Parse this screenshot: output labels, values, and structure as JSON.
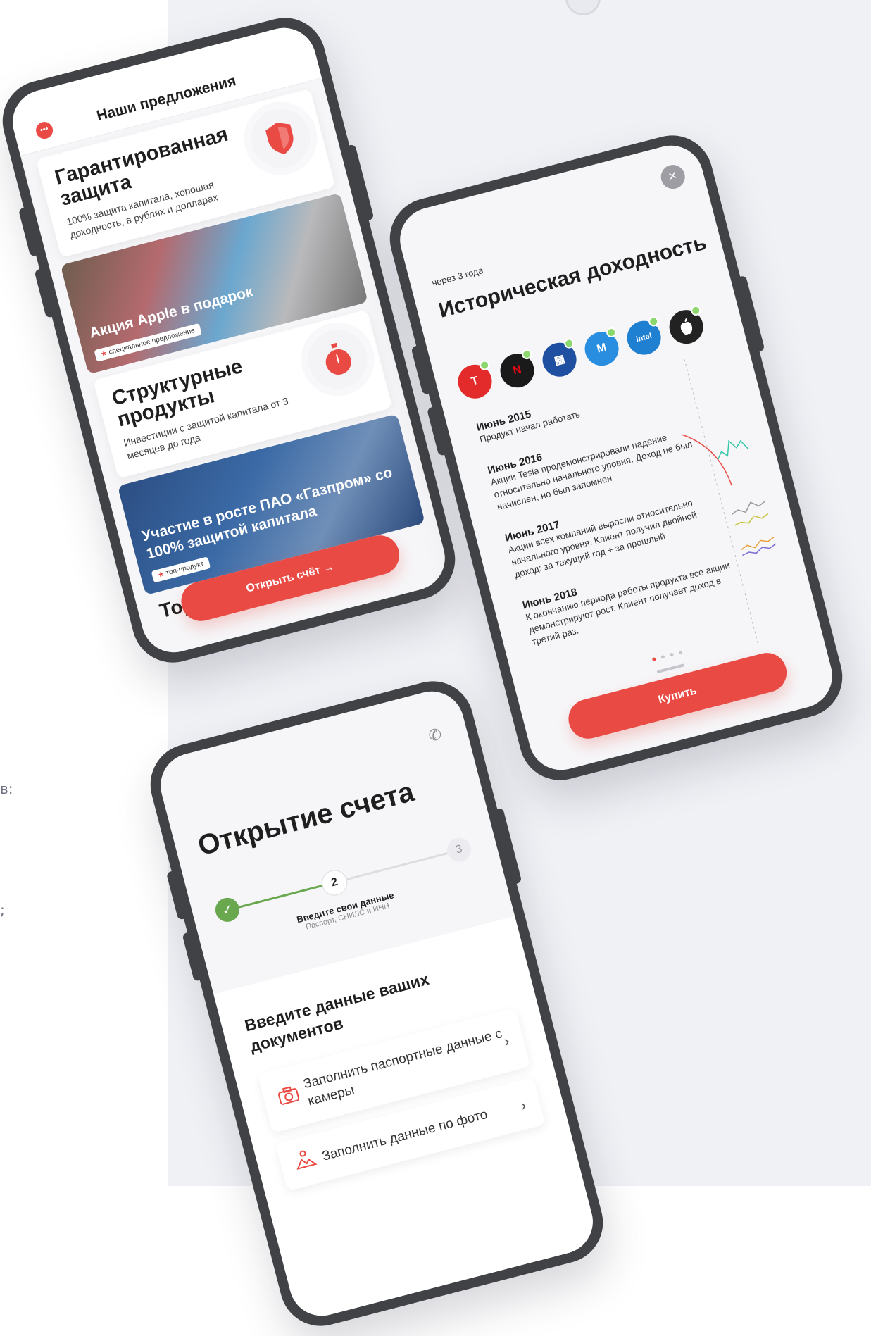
{
  "edge_chars": [
    "в:",
    ";"
  ],
  "phone1": {
    "header_title": "Наши предложения",
    "chat_icon": "•••",
    "cards": [
      {
        "title": "Гарантированная защита",
        "desc": "100% защита капитала, хорошая доходность, в рублях и долларах",
        "icon": "shield-icon"
      },
      {
        "title": "Структурные продукты",
        "desc": "Инвестиции с защитой капитала от 3 месяцев до года",
        "icon": "stopwatch-icon"
      }
    ],
    "promos": [
      {
        "title": "Акция Apple в подарок",
        "tag": "специальное предложение"
      },
      {
        "title": "Участие в росте ПАО «Газпром» со 100% защитой капитала",
        "tag": "топ-продукт"
      }
    ],
    "cut_title": "Торговые",
    "cta_label": "Открыть счёт →",
    "accent": "#e94a44"
  },
  "phone2": {
    "close_label": "×",
    "subtitle": "через 3 года",
    "title": "Историческая доходность",
    "logos": [
      {
        "name": "tesla-logo",
        "glyph": "T",
        "color": "#e32b2b"
      },
      {
        "name": "netflix-logo",
        "glyph": "N",
        "color": "#1a1a1a"
      },
      {
        "name": "microsoft-logo",
        "glyph": "▦",
        "color": "#1e4fa1"
      },
      {
        "name": "mobile-logo",
        "glyph": "M",
        "color": "#2a8ee0"
      },
      {
        "name": "intel-logo",
        "glyph": "intel",
        "color": "#1f7fd1"
      },
      {
        "name": "apple-logo",
        "glyph": "",
        "color": "#222222"
      }
    ],
    "timeline": [
      {
        "year": "Июнь 2015",
        "text": "Продукт начал работать"
      },
      {
        "year": "Июнь 2016",
        "text": "Акции Tesla продемонстрировали падение относительно начального уровня. Доход не был начислен, но был запомнен"
      },
      {
        "year": "Июнь 2017",
        "text": "Акции всех компаний выросли относительно начального уровня. Клиент получил двойной доход: за текущий год + за прошлый"
      },
      {
        "year": "Июнь 2018",
        "text": "К окончанию периода работы продукта все акции демонстрируют рост. Клиент получает доход в третий раз."
      }
    ],
    "cta_label": "Купить"
  },
  "phone3": {
    "title": "Открытие счета",
    "steps": {
      "current": "2",
      "next": "3",
      "label": "Введите свои данные",
      "sublabel": "Паспорт, СНИЛС и ИНН"
    },
    "section_title": "Введите данные ваших документов",
    "rows": [
      {
        "label": "Заполнить паспортные данные с камеры",
        "icon": "camera-icon"
      },
      {
        "label": "Заполнить данные по фото",
        "icon": "photo-icon"
      }
    ]
  }
}
